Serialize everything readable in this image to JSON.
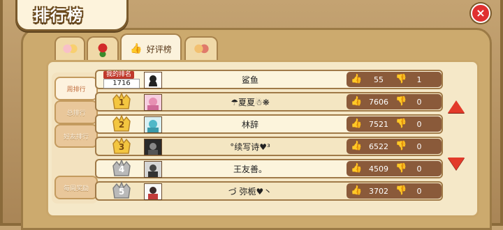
{
  "window": {
    "title": "排行榜",
    "close_label": "×"
  },
  "tabs": [
    {
      "icon": "couple-icon",
      "label": ""
    },
    {
      "icon": "rose-icon",
      "label": ""
    },
    {
      "icon": "thumbs-up-icon",
      "label": "好评榜"
    },
    {
      "icon": "friends-icon",
      "label": ""
    }
  ],
  "menu": {
    "items": [
      "周排行",
      "总排行",
      "好友排行"
    ],
    "bottom": "每周奖励"
  },
  "my_rank": {
    "label": "我的排名",
    "value": "1716",
    "name": "鲨鱼",
    "likes": "55",
    "dislikes": "1"
  },
  "rows": [
    {
      "rank": "1",
      "name": "☂夏夏☃❋",
      "likes": "7606",
      "dislikes": "0"
    },
    {
      "rank": "2",
      "name": "林辞",
      "likes": "7521",
      "dislikes": "0"
    },
    {
      "rank": "3",
      "name": "°续写诗♥³",
      "likes": "6522",
      "dislikes": "0"
    },
    {
      "rank": "4",
      "name": "王友善。",
      "likes": "4509",
      "dislikes": "0"
    },
    {
      "rank": "5",
      "name": "づ 弥栀♥丶",
      "likes": "3702",
      "dislikes": "0"
    }
  ],
  "colors": {
    "gold": "#f3c640",
    "silver": "#b9b9b9",
    "accent_red": "#e03030",
    "likes_bg": "#8a5a3a"
  }
}
